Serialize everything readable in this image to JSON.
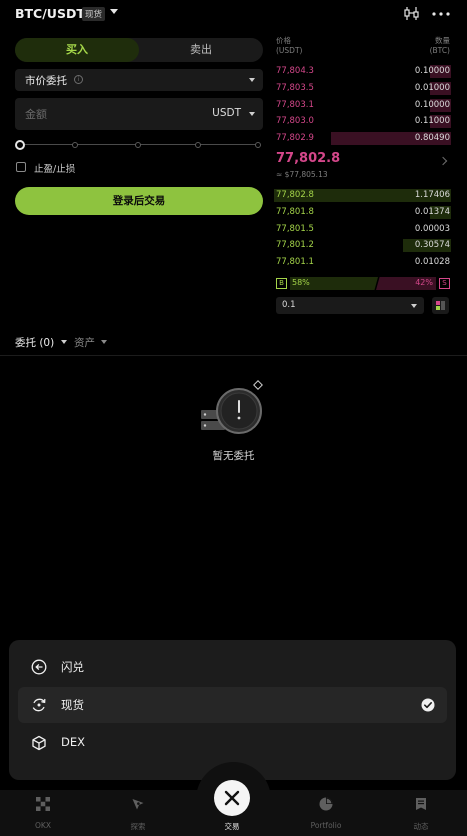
{
  "header": {
    "pair": "BTC/USDT",
    "tag": "现货"
  },
  "order_form": {
    "tab_buy": "买入",
    "tab_sell": "卖出",
    "order_type": "市价委托",
    "amount_placeholder": "金额",
    "amount_unit": "USDT",
    "tpsl_label": "止盈/止损",
    "login_button": "登录后交易"
  },
  "orderbook": {
    "price_header": [
      "价格",
      "(USDT)"
    ],
    "amount_header": [
      "数量",
      "(BTC)"
    ],
    "asks": [
      {
        "price": "77,804.3",
        "amount": "0.10000",
        "depth": 0.12
      },
      {
        "price": "77,803.5",
        "amount": "0.01000",
        "depth": 0.12
      },
      {
        "price": "77,803.1",
        "amount": "0.10000",
        "depth": 0.12
      },
      {
        "price": "77,803.0",
        "amount": "0.11000",
        "depth": 0.12
      },
      {
        "price": "77,802.9",
        "amount": "0.80490",
        "depth": 0.68
      }
    ],
    "last_price": "77,802.8",
    "last_price_fiat": "≈ $77,805.13",
    "bids": [
      {
        "price": "77,802.8",
        "amount": "1.17406",
        "depth": 1.0
      },
      {
        "price": "77,801.8",
        "amount": "0.01374",
        "depth": 0.12
      },
      {
        "price": "77,801.5",
        "amount": "0.00003",
        "depth": 0.0
      },
      {
        "price": "77,801.2",
        "amount": "0.30574",
        "depth": 0.27
      },
      {
        "price": "77,801.1",
        "amount": "0.01028",
        "depth": 0.0
      }
    ],
    "buy_badge": "B",
    "sell_badge": "S",
    "buy_ratio": "58%",
    "sell_ratio": "42%",
    "precision": "0.1"
  },
  "orders": {
    "tab_orders": "委托 (0)",
    "tab_assets": "资产",
    "empty_text": "暂无委托"
  },
  "sheet": {
    "items": [
      {
        "label": "闪兑",
        "icon": "convert-icon",
        "selected": false
      },
      {
        "label": "现货",
        "icon": "spot-icon",
        "selected": true
      },
      {
        "label": "DEX",
        "icon": "dex-cube-icon",
        "selected": false
      }
    ]
  },
  "nav": {
    "items": [
      {
        "label": "OKX",
        "icon": "okx-logo-icon"
      },
      {
        "label": "探索",
        "icon": "explore-compass-icon"
      },
      {
        "label": "交易",
        "icon": "close-icon"
      },
      {
        "label": "Portfolio",
        "icon": "portfolio-pie-icon"
      },
      {
        "label": "动态",
        "icon": "feed-doc-icon"
      }
    ]
  },
  "colors": {
    "accent_green": "#8ec33f",
    "ask_red": "#d4478a",
    "bid_green": "#a4d449",
    "background": "#000000"
  }
}
